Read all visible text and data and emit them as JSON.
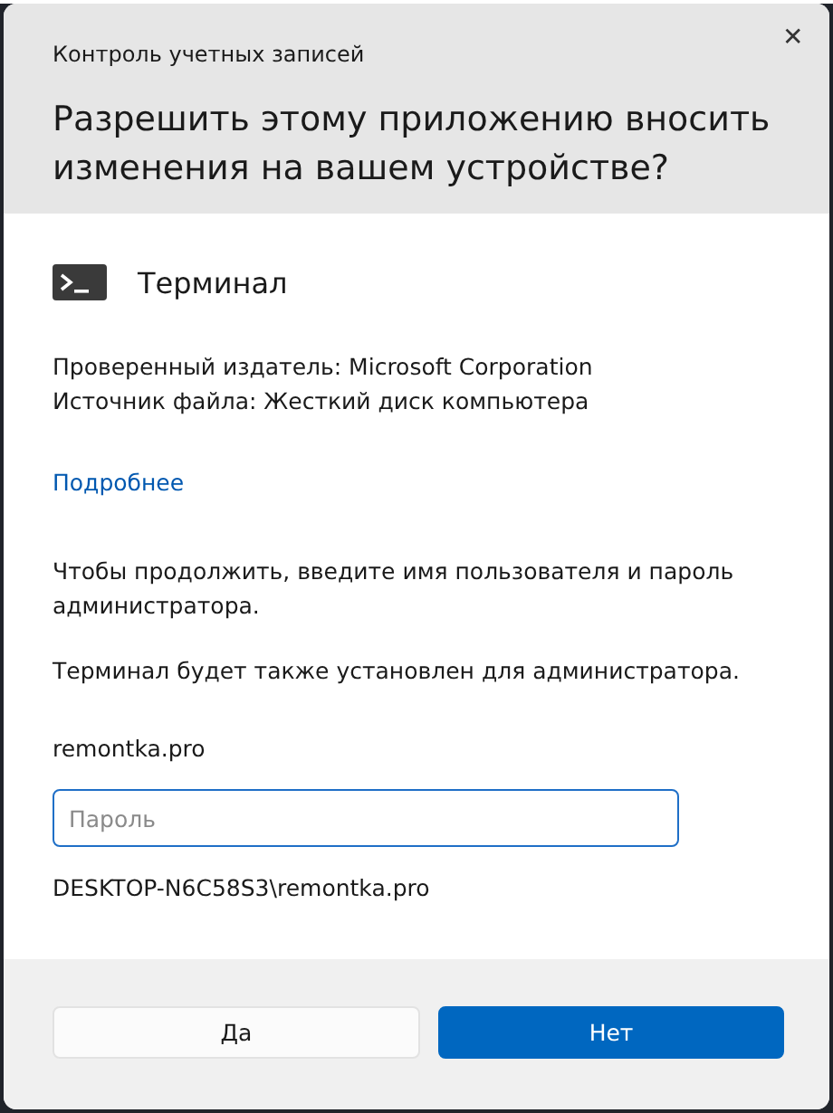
{
  "window": {
    "title": "Контроль учетных записей",
    "close_glyph": "✕"
  },
  "heading": "Разрешить этому приложению вносить изменения на вашем устройстве?",
  "app": {
    "name": "Терминал"
  },
  "details": [
    "Проверенный издатель: Microsoft Corporation",
    "Источник файла: Жесткий диск компьютера"
  ],
  "more_link": "Подробнее",
  "prompt": "Чтобы продолжить, введите имя пользователя и пароль администратора.",
  "note": "Терминал будет также установлен для администратора.",
  "username": "remontka.pro",
  "password_field": {
    "placeholder": "Пароль"
  },
  "account": "DESKTOP-N6C58S3\\remontka.pro",
  "buttons": [
    {
      "label": "Да",
      "kind": "secondary"
    },
    {
      "label": "Нет",
      "kind": "primary"
    }
  ]
}
